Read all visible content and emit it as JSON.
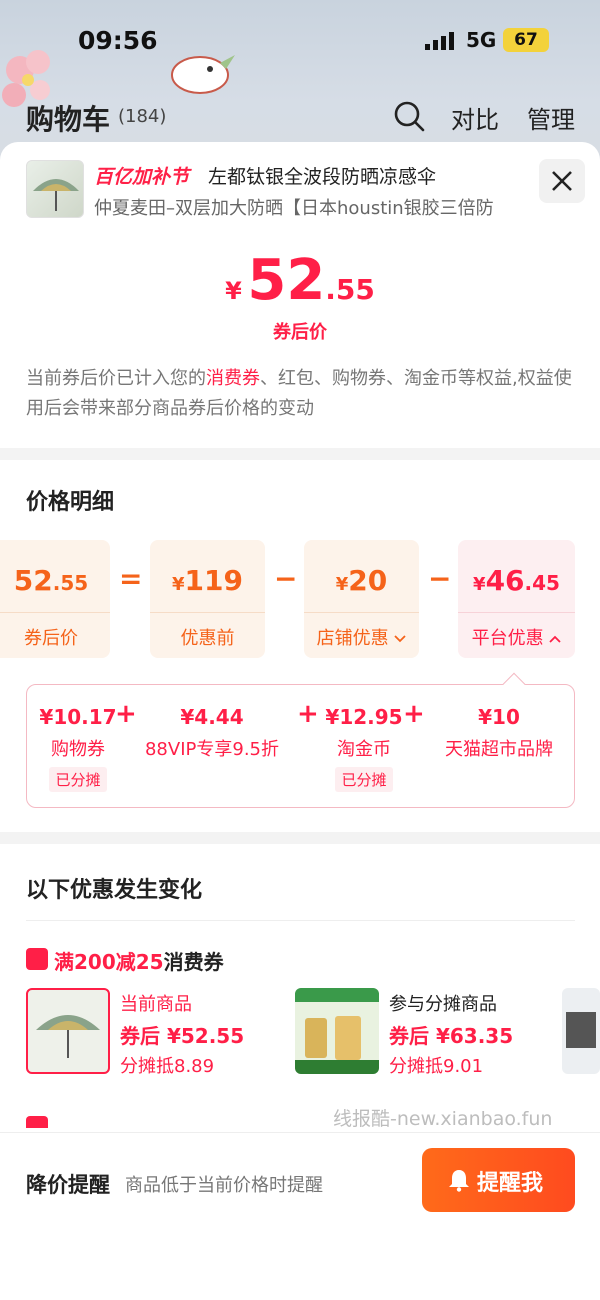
{
  "status": {
    "time": "09:56",
    "network": "5G",
    "battery": "67"
  },
  "appbar": {
    "title": "购物车",
    "count": "(184)",
    "compare": "对比",
    "manage": "管理"
  },
  "product": {
    "festival": "百亿加补节",
    "name": "左都钛银全波段防晒凉感伞",
    "subname": "仲夏麦田–双层加大防晒【日本houstin银胶三倍防"
  },
  "price": {
    "yen": "¥",
    "int": "52",
    "dec": ".55",
    "label": "券后价"
  },
  "note": {
    "p1": "当前券后价已计入您的",
    "highlight": "消费券",
    "p2": "、红包、购物券、淘金币等权益,权益使用后会带来部分商品券后价格的变动"
  },
  "breakdown": {
    "title": "价格明细",
    "boxes": [
      {
        "yen": "",
        "int": "52",
        "dec": ".55",
        "label": "券后价"
      },
      {
        "yen": "¥",
        "int": "119",
        "dec": "",
        "label": "优惠前"
      },
      {
        "yen": "¥",
        "int": "20",
        "dec": "",
        "label": "店铺优惠"
      },
      {
        "yen": "¥",
        "int": "46",
        "dec": ".45",
        "label": "平台优惠"
      }
    ],
    "ops": [
      "=",
      "−",
      "−"
    ],
    "details": [
      {
        "value": "¥10.17",
        "label": "购物券",
        "tag": "已分摊"
      },
      {
        "value": "¥4.44",
        "label": "88VIP专享9.5折",
        "tag": ""
      },
      {
        "value": "¥12.95",
        "label": "淘金币",
        "tag": "已分摊"
      },
      {
        "value": "¥10",
        "label": "天猫超市品牌",
        "tag": ""
      }
    ],
    "plus": "+"
  },
  "changes": {
    "title": "以下优惠发生变化",
    "coupon": {
      "red": "满200减25",
      "dark": "消费券"
    },
    "items": [
      {
        "t1": "当前商品",
        "t2": "券后 ¥52.55",
        "t3": "分摊抵8.89"
      },
      {
        "t1": "参与分摊商品",
        "t2": "券后 ¥63.35",
        "t3": "分摊抵9.01"
      }
    ]
  },
  "watermark": "线报酷-new.xianbao.fun",
  "footer": {
    "title": "降价提醒",
    "desc": "商品低于当前价格时提醒",
    "button": "提醒我"
  },
  "colors": {
    "accent": "#ff1f47",
    "orange": "#f5631a",
    "button": "#ff5a1d"
  }
}
